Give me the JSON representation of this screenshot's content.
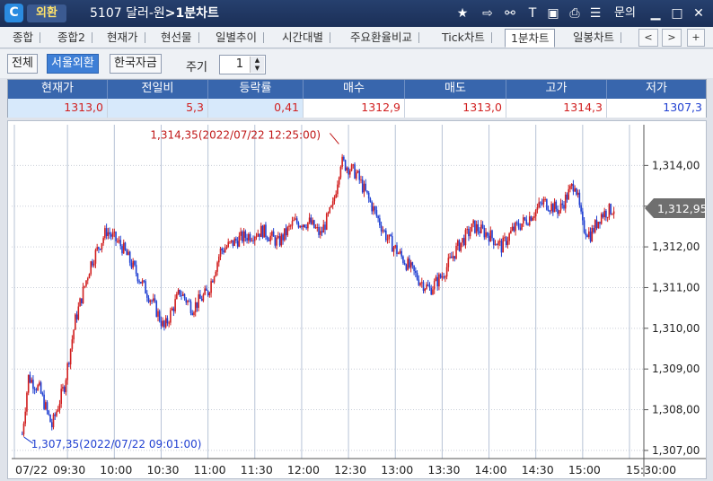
{
  "titlebar": {
    "badge": "외환",
    "code": "5107 달러-원",
    "arrow": ">",
    "screen": "1분차트",
    "help": "문의",
    "icons": [
      "star-icon",
      "export-icon",
      "link-icon",
      "text-icon",
      "save-icon",
      "print-icon",
      "list-icon",
      "minimize-icon",
      "maximize-icon",
      "close-icon"
    ]
  },
  "tabs": [
    {
      "label": "종합"
    },
    {
      "label": "종합2"
    },
    {
      "label": "현재가"
    },
    {
      "label": "현선물"
    },
    {
      "label": "일별추이"
    },
    {
      "label": "시간대별"
    },
    {
      "label": "주요환율비교"
    },
    {
      "label": "Tick차트"
    },
    {
      "label": "1분차트",
      "active": true
    },
    {
      "label": "일봉차트"
    }
  ],
  "tab_nav": {
    "prev": "<",
    "next": ">",
    "add": "+"
  },
  "filter": {
    "buttons": [
      {
        "label": "전체"
      },
      {
        "label": "서울외환",
        "active": true
      },
      {
        "label": "한국자금"
      }
    ],
    "period_label": "주기",
    "period_value": "1"
  },
  "quote": {
    "headers": [
      "현재가",
      "전일비",
      "등락률",
      "매수",
      "매도",
      "고가",
      "저가"
    ],
    "values": [
      "1313,0",
      "5,3",
      "0,41",
      "1312,9",
      "1313,0",
      "1314,3",
      "1307,3"
    ]
  },
  "chart_data": {
    "type": "candlestick",
    "x_ticks": [
      "07/22",
      "09:30",
      "10:00",
      "10:30",
      "11:00",
      "11:30",
      "12:00",
      "12:30",
      "13:00",
      "13:30",
      "14:00",
      "14:30",
      "15:00",
      "15:30:00"
    ],
    "y_ticks": [
      "1,314,00",
      "1,313,00",
      "1,312,00",
      "1,311,00",
      "1,310,00",
      "1,309,00",
      "1,308,00",
      "1,307,00"
    ],
    "y_range": [
      1306.8,
      1315.0
    ],
    "current_value_label": "1,312,95",
    "current_value": 1312.95,
    "annotations": [
      {
        "text": "1,314,35(2022/07/22 12:25:00)",
        "time": "12:25",
        "value": 1314.35
      },
      {
        "text": "1,307,35(2022/07/22 09:01:00)",
        "time": "09:01",
        "value": 1307.35
      }
    ],
    "up_color": "#d11f1f",
    "down_color": "#1f3fd1",
    "approx_closes": [
      {
        "time": "09:01",
        "value": 1307.4
      },
      {
        "time": "09:05",
        "value": 1308.8
      },
      {
        "time": "09:12",
        "value": 1308.5
      },
      {
        "time": "09:20",
        "value": 1307.6
      },
      {
        "time": "09:28",
        "value": 1308.6
      },
      {
        "time": "09:35",
        "value": 1310.2
      },
      {
        "time": "09:45",
        "value": 1311.6
      },
      {
        "time": "09:55",
        "value": 1312.4
      },
      {
        "time": "10:05",
        "value": 1312.0
      },
      {
        "time": "10:15",
        "value": 1311.3
      },
      {
        "time": "10:25",
        "value": 1310.6
      },
      {
        "time": "10:32",
        "value": 1310.0
      },
      {
        "time": "10:42",
        "value": 1310.9
      },
      {
        "time": "10:50",
        "value": 1310.5
      },
      {
        "time": "11:00",
        "value": 1310.9
      },
      {
        "time": "11:08",
        "value": 1311.9
      },
      {
        "time": "11:20",
        "value": 1312.2
      },
      {
        "time": "11:35",
        "value": 1312.4
      },
      {
        "time": "11:45",
        "value": 1312.1
      },
      {
        "time": "11:55",
        "value": 1312.6
      },
      {
        "time": "12:05",
        "value": 1312.6
      },
      {
        "time": "12:12",
        "value": 1312.3
      },
      {
        "time": "12:20",
        "value": 1313.0
      },
      {
        "time": "12:25",
        "value": 1314.1
      },
      {
        "time": "12:35",
        "value": 1313.8
      },
      {
        "time": "12:45",
        "value": 1313.0
      },
      {
        "time": "12:55",
        "value": 1312.2
      },
      {
        "time": "13:05",
        "value": 1311.7
      },
      {
        "time": "13:15",
        "value": 1311.2
      },
      {
        "time": "13:22",
        "value": 1310.95
      },
      {
        "time": "13:30",
        "value": 1311.3
      },
      {
        "time": "13:40",
        "value": 1312.0
      },
      {
        "time": "13:50",
        "value": 1312.5
      },
      {
        "time": "14:00",
        "value": 1312.3
      },
      {
        "time": "14:08",
        "value": 1312.0
      },
      {
        "time": "14:15",
        "value": 1312.4
      },
      {
        "time": "14:25",
        "value": 1312.7
      },
      {
        "time": "14:35",
        "value": 1313.1
      },
      {
        "time": "14:45",
        "value": 1312.9
      },
      {
        "time": "14:55",
        "value": 1313.6
      },
      {
        "time": "15:00",
        "value": 1312.5
      },
      {
        "time": "15:05",
        "value": 1312.3
      },
      {
        "time": "15:12",
        "value": 1312.8
      },
      {
        "time": "15:20",
        "value": 1312.95
      }
    ]
  }
}
